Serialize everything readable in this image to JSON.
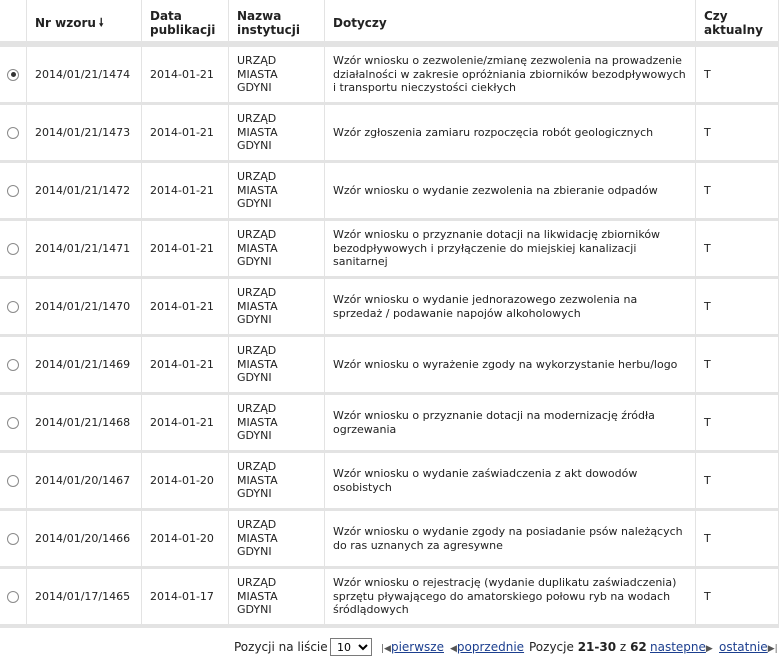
{
  "table": {
    "headers": {
      "nr": "Nr wzoru",
      "data": "Data\npublikacji",
      "nazwa": "Nazwa\ninstytucji",
      "dotyczy": "Dotyczy",
      "aktualny": "Czy\naktualny"
    },
    "sort_icon": "arrow-down",
    "rows": [
      {
        "nr": "2014/01/21/1474",
        "date": "2014-01-21",
        "inst": "URZĄD\nMIASTA\nGDYNI",
        "desc": "Wzór wniosku o zezwolenie/zmianę zezwolenia na prowadzenie działalności w zakresie opróżniania zbiorników bezodpływowych i transportu nieczystości ciekłych",
        "akt": "T",
        "selected": true
      },
      {
        "nr": "2014/01/21/1473",
        "date": "2014-01-21",
        "inst": "URZĄD\nMIASTA\nGDYNI",
        "desc": "Wzór zgłoszenia zamiaru rozpoczęcia robót geologicznych",
        "akt": "T",
        "selected": false
      },
      {
        "nr": "2014/01/21/1472",
        "date": "2014-01-21",
        "inst": "URZĄD\nMIASTA\nGDYNI",
        "desc": "Wzór wniosku o wydanie zezwolenia na zbieranie odpadów",
        "akt": "T",
        "selected": false
      },
      {
        "nr": "2014/01/21/1471",
        "date": "2014-01-21",
        "inst": "URZĄD\nMIASTA\nGDYNI",
        "desc": "Wzór wniosku o przyznanie dotacji na likwidację zbiorników bezodpływowych i przyłączenie do miejskiej kanalizacji sanitarnej",
        "akt": "T",
        "selected": false
      },
      {
        "nr": "2014/01/21/1470",
        "date": "2014-01-21",
        "inst": "URZĄD\nMIASTA\nGDYNI",
        "desc": "Wzór wniosku o wydanie jednorazowego zezwolenia na sprzedaż / podawanie napojów alkoholowych",
        "akt": "T",
        "selected": false
      },
      {
        "nr": "2014/01/21/1469",
        "date": "2014-01-21",
        "inst": "URZĄD\nMIASTA\nGDYNI",
        "desc": "Wzór wniosku o wyrażenie zgody na wykorzystanie herbu/logo",
        "akt": "T",
        "selected": false
      },
      {
        "nr": "2014/01/21/1468",
        "date": "2014-01-21",
        "inst": "URZĄD\nMIASTA\nGDYNI",
        "desc": "Wzór wniosku o przyznanie dotacji na modernizację źródła ogrzewania",
        "akt": "T",
        "selected": false
      },
      {
        "nr": "2014/01/20/1467",
        "date": "2014-01-20",
        "inst": "URZĄD\nMIASTA\nGDYNI",
        "desc": "Wzór wniosku o wydanie zaświadczenia z akt dowodów osobistych",
        "akt": "T",
        "selected": false
      },
      {
        "nr": "2014/01/20/1466",
        "date": "2014-01-20",
        "inst": "URZĄD\nMIASTA\nGDYNI",
        "desc": "Wzór wniosku o wydanie zgody na posiadanie psów należących do ras uznanych za agresywne",
        "akt": "T",
        "selected": false
      },
      {
        "nr": "2014/01/17/1465",
        "date": "2014-01-17",
        "inst": "URZĄD\nMIASTA\nGDYNI",
        "desc": "Wzór wniosku o rejestrację (wydanie duplikatu zaświadczenia) sprzętu pływającego do amatorskiego połowu ryb na wodach śródlądowych",
        "akt": "T",
        "selected": false
      }
    ]
  },
  "pager": {
    "per_page_label": "Pozycji na liście",
    "per_page_value": "10",
    "first": "pierwsze",
    "prev": "poprzednie",
    "positions_label": "Pozycje",
    "range": "21-30",
    "of": "z",
    "total": "62",
    "next": "nastepne",
    "last": "ostatnie"
  }
}
